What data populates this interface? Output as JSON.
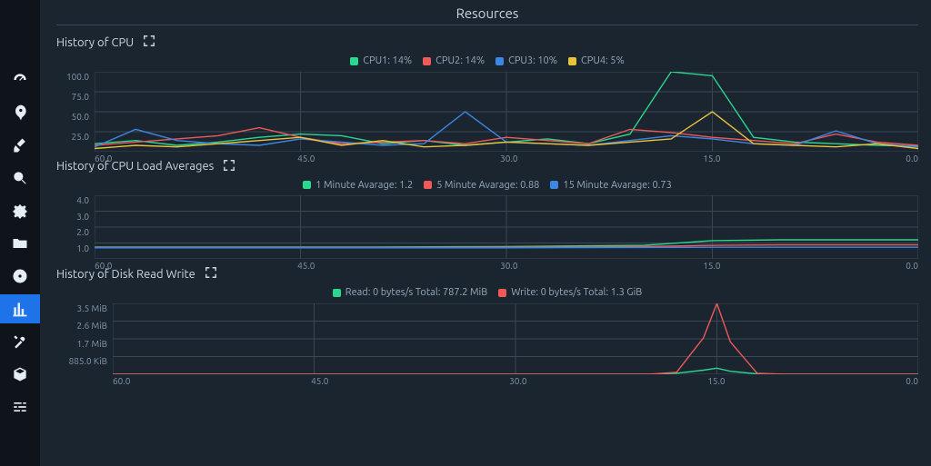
{
  "page_title": "Resources",
  "sidebar": {
    "items": [
      {
        "name": "dashboard",
        "selected": false
      },
      {
        "name": "startup",
        "selected": false
      },
      {
        "name": "cleaner",
        "selected": false
      },
      {
        "name": "search",
        "selected": false
      },
      {
        "name": "services",
        "selected": false
      },
      {
        "name": "packages",
        "selected": false
      },
      {
        "name": "disk",
        "selected": false
      },
      {
        "name": "resources",
        "selected": true
      },
      {
        "name": "tools",
        "selected": false
      },
      {
        "name": "files",
        "selected": false
      },
      {
        "name": "settings",
        "selected": false
      }
    ]
  },
  "panels": {
    "cpu": {
      "title": "History of CPU",
      "legend": [
        {
          "label": "CPU1: 14%",
          "color": "#2bd68f"
        },
        {
          "label": "CPU2: 14%",
          "color": "#ef5a58"
        },
        {
          "label": "CPU3: 10%",
          "color": "#3d86e2"
        },
        {
          "label": "CPU4: 5%",
          "color": "#e9c23c"
        }
      ]
    },
    "load": {
      "title": "History of CPU Load Averages",
      "legend": [
        {
          "label": "1 Minute Avarage: 1.2",
          "color": "#2bd68f"
        },
        {
          "label": "5 Minute Avarage: 0.88",
          "color": "#ef5a58"
        },
        {
          "label": "15 Minute Avarage: 0.73",
          "color": "#3d86e2"
        }
      ]
    },
    "disk": {
      "title": "History of Disk Read Write",
      "legend": [
        {
          "label": "Read: 0 bytes/s Total: 787.2 MiB",
          "color": "#2bd68f"
        },
        {
          "label": "Write: 0 bytes/s Total: 1.3 GiB",
          "color": "#ef5a58"
        }
      ]
    }
  },
  "chart_data": [
    {
      "id": "cpu",
      "type": "line",
      "title": "History of CPU",
      "xlabel": "",
      "ylabel": "",
      "x_ticks": [
        "60.0",
        "45.0",
        "30.0",
        "15.0",
        "0.0"
      ],
      "y_ticks": [
        "100.0",
        "75.0",
        "50.0",
        "25.0",
        ""
      ],
      "xlim": [
        60,
        0
      ],
      "ylim": [
        0,
        100
      ],
      "x": [
        60,
        57,
        54,
        51,
        48,
        45,
        42,
        39,
        36,
        33,
        30,
        27,
        24,
        21,
        18,
        15,
        12,
        9,
        6,
        3,
        0
      ],
      "series": [
        {
          "name": "CPU1",
          "color": "#2bd68f",
          "values": [
            10,
            14,
            8,
            12,
            18,
            22,
            20,
            10,
            14,
            8,
            12,
            16,
            10,
            22,
            100,
            95,
            18,
            12,
            10,
            8,
            7
          ]
        },
        {
          "name": "CPU2",
          "color": "#ef5a58",
          "values": [
            8,
            12,
            16,
            20,
            30,
            18,
            10,
            12,
            14,
            10,
            18,
            14,
            10,
            28,
            24,
            18,
            14,
            10,
            22,
            12,
            8
          ]
        },
        {
          "name": "CPU3",
          "color": "#3d86e2",
          "values": [
            6,
            28,
            14,
            10,
            8,
            16,
            12,
            8,
            10,
            50,
            12,
            10,
            8,
            14,
            20,
            16,
            10,
            8,
            26,
            10,
            6
          ]
        },
        {
          "name": "CPU4",
          "color": "#e9c23c",
          "values": [
            4,
            8,
            6,
            10,
            14,
            18,
            8,
            14,
            6,
            8,
            12,
            10,
            8,
            12,
            16,
            50,
            10,
            8,
            6,
            10,
            4
          ]
        }
      ]
    },
    {
      "id": "load",
      "type": "line",
      "title": "History of CPU Load Averages",
      "x_ticks": [
        "60.0",
        "45.0",
        "30.0",
        "15.0",
        "0.0"
      ],
      "y_ticks": [
        "4.0",
        "3.0",
        "2.0",
        "1.0",
        ""
      ],
      "xlim": [
        60,
        0
      ],
      "ylim": [
        0,
        4
      ],
      "x": [
        60,
        50,
        40,
        30,
        20,
        15,
        10,
        5,
        0
      ],
      "series": [
        {
          "name": "1 Minute",
          "color": "#2bd68f",
          "values": [
            0.75,
            0.75,
            0.75,
            0.78,
            0.85,
            1.15,
            1.2,
            1.2,
            1.2
          ]
        },
        {
          "name": "5 Minute",
          "color": "#ef5a58",
          "values": [
            0.72,
            0.72,
            0.72,
            0.73,
            0.78,
            0.85,
            0.88,
            0.88,
            0.88
          ]
        },
        {
          "name": "15 Minute",
          "color": "#3d86e2",
          "values": [
            0.7,
            0.7,
            0.7,
            0.7,
            0.72,
            0.73,
            0.73,
            0.73,
            0.73
          ]
        }
      ]
    },
    {
      "id": "disk",
      "type": "line",
      "title": "History of Disk Read Write",
      "x_ticks": [
        "60.0",
        "45.0",
        "30.0",
        "15.0",
        "0.0"
      ],
      "y_ticks": [
        "3.5 MiB",
        "2.6 MiB",
        "1.7 MiB",
        "885.0 KiB",
        ""
      ],
      "xlim": [
        60,
        0
      ],
      "ylim": [
        0,
        3.5
      ],
      "x": [
        60,
        50,
        40,
        30,
        20,
        18,
        16,
        15,
        14,
        12,
        10,
        5,
        0
      ],
      "series": [
        {
          "name": "Read",
          "color": "#2bd68f",
          "values": [
            0,
            0,
            0,
            0,
            0,
            0.05,
            0.2,
            0.3,
            0.15,
            0.02,
            0,
            0,
            0
          ]
        },
        {
          "name": "Write",
          "color": "#ef5a58",
          "values": [
            0,
            0,
            0,
            0,
            0,
            0.1,
            1.8,
            3.5,
            1.6,
            0.05,
            0,
            0,
            0
          ]
        }
      ]
    }
  ]
}
